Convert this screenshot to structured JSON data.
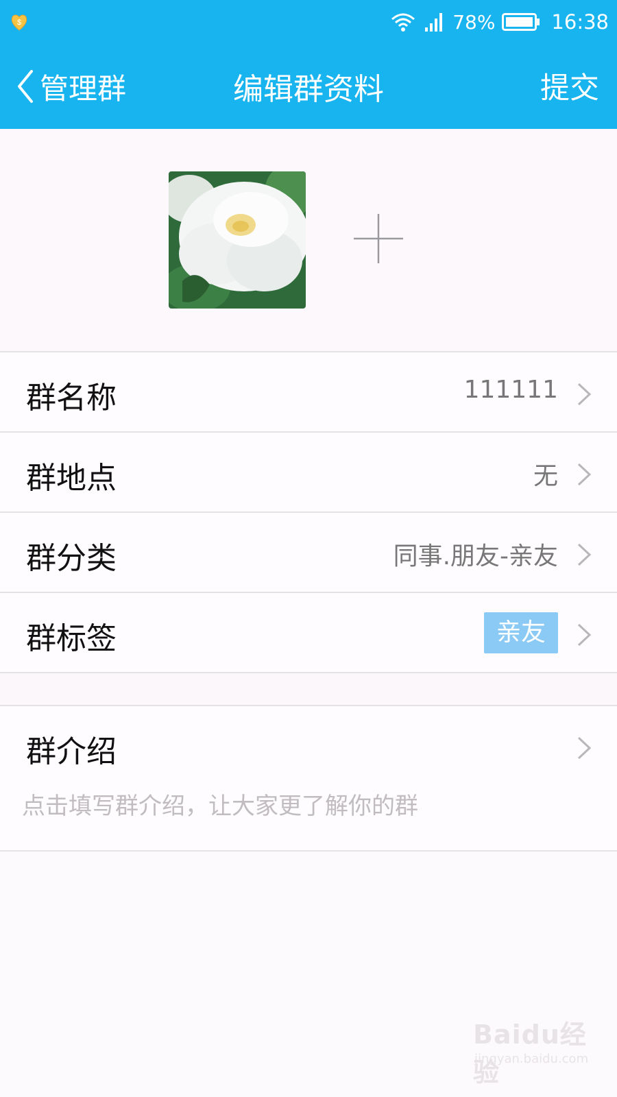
{
  "status_bar": {
    "battery": "78%",
    "time": "16:38",
    "icons": [
      "app-notification-icon",
      "wifi-icon",
      "signal-icon",
      "battery-icon"
    ]
  },
  "nav": {
    "back_label": "管理群",
    "title": "编辑群资料",
    "submit_label": "提交"
  },
  "colors": {
    "header_bg": "#17b4f0",
    "tag_bg": "#8ccaf6"
  },
  "rows": [
    {
      "label": "群名称",
      "value": "111111"
    },
    {
      "label": "群地点",
      "value": "无"
    },
    {
      "label": "群分类",
      "value": "同事.朋友-亲友"
    },
    {
      "label": "群标签",
      "tag": "亲友"
    }
  ],
  "intro": {
    "label": "群介绍",
    "placeholder": "点击填写群介绍，让大家更了解你的群"
  },
  "watermark": {
    "brand": "Baidu经验",
    "url": "jingyan.baidu.com"
  }
}
